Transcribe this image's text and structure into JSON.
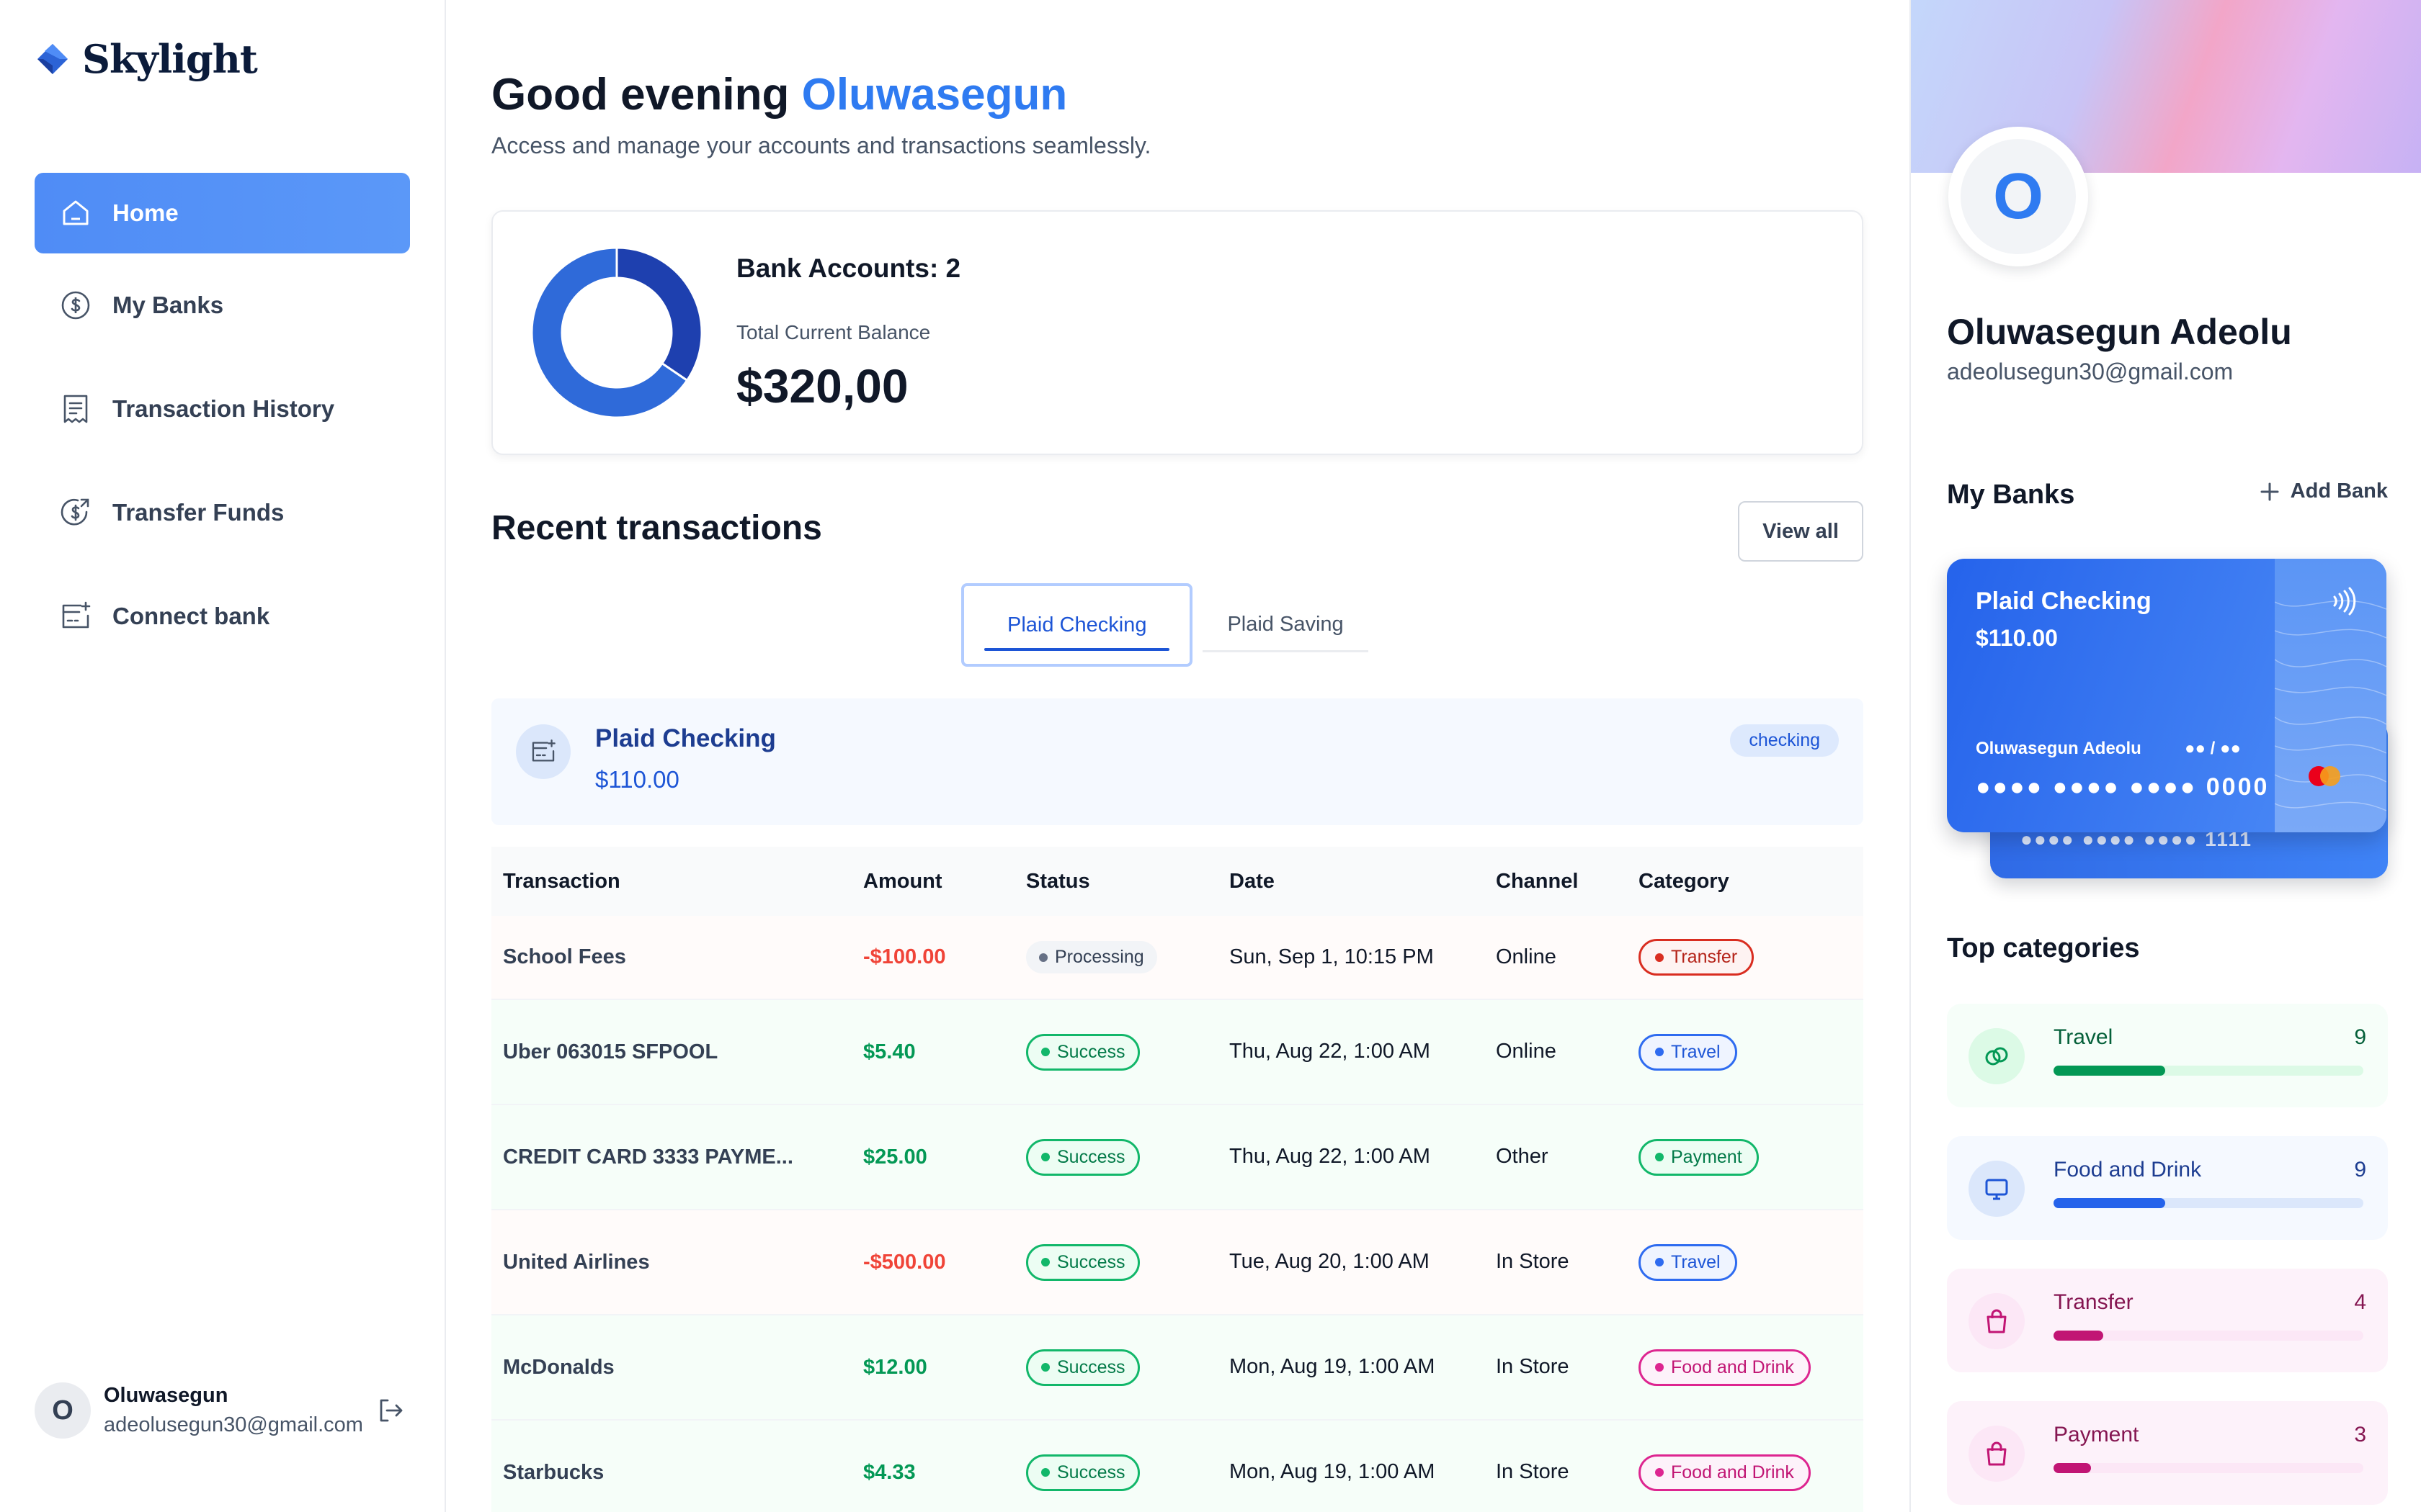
{
  "app": {
    "name": "Skylight"
  },
  "sidebar": {
    "items": [
      {
        "label": "Home",
        "icon": "home-icon",
        "active": true
      },
      {
        "label": "My Banks",
        "icon": "dollar-circle-icon",
        "active": false
      },
      {
        "label": "Transaction History",
        "icon": "receipt-icon",
        "active": false
      },
      {
        "label": "Transfer Funds",
        "icon": "money-send-icon",
        "active": false
      },
      {
        "label": "Connect bank",
        "icon": "connect-bank-icon",
        "active": false
      }
    ],
    "footer": {
      "avatar_initial": "O",
      "name": "Oluwasegun",
      "email": "adeolusegun30@gmail.com",
      "logout_icon": "logout-icon"
    }
  },
  "header": {
    "greeting_prefix": "Good evening",
    "user_first_name": "Oluwasegun",
    "subtitle": "Access and manage your accounts and transactions seamlessly."
  },
  "balance": {
    "bank_accounts_label": "Bank Accounts: 2",
    "total_label": "Total Current Balance",
    "total_value": "$320,00",
    "donut_shares": [
      0.345,
      0.655
    ],
    "donut_colors": [
      "#1e40af",
      "#2f6ad9"
    ]
  },
  "recent": {
    "title": "Recent transactions",
    "view_all_label": "View all",
    "tabs": [
      {
        "label": "Plaid Checking",
        "active": true
      },
      {
        "label": "Plaid Saving",
        "active": false
      }
    ],
    "account": {
      "name": "Plaid Checking",
      "balance": "$110.00",
      "badge": "checking"
    },
    "columns": [
      "Transaction",
      "Amount",
      "Status",
      "Date",
      "Channel",
      "Category"
    ],
    "rows": [
      {
        "name": "School Fees",
        "amount": "-$100.00",
        "type": "debit",
        "status": "Processing",
        "date": "Sun, Sep 1, 10:15 PM",
        "channel": "Online",
        "category": "Transfer",
        "cat_class": "cat-transfer"
      },
      {
        "name": "Uber 063015 SFPOOL",
        "amount": "$5.40",
        "type": "credit",
        "status": "Success",
        "date": "Thu, Aug 22, 1:00 AM",
        "channel": "Online",
        "category": "Travel",
        "cat_class": "cat-travel"
      },
      {
        "name": "CREDIT CARD 3333 PAYME...",
        "amount": "$25.00",
        "type": "credit",
        "status": "Success",
        "date": "Thu, Aug 22, 1:00 AM",
        "channel": "Other",
        "category": "Payment",
        "cat_class": "cat-payment"
      },
      {
        "name": "United Airlines",
        "amount": "-$500.00",
        "type": "debit",
        "status": "Success",
        "date": "Tue, Aug 20, 1:00 AM",
        "channel": "In Store",
        "category": "Travel",
        "cat_class": "cat-travel"
      },
      {
        "name": "McDonalds",
        "amount": "$12.00",
        "type": "credit",
        "status": "Success",
        "date": "Mon, Aug 19, 1:00 AM",
        "channel": "In Store",
        "category": "Food and Drink",
        "cat_class": "cat-food"
      },
      {
        "name": "Starbucks",
        "amount": "$4.33",
        "type": "credit",
        "status": "Success",
        "date": "Mon, Aug 19, 1:00 AM",
        "channel": "In Store",
        "category": "Food and Drink",
        "cat_class": "cat-food"
      }
    ]
  },
  "profile": {
    "avatar_initial": "O",
    "name": "Oluwasegun Adeolu",
    "email": "adeolusegun30@gmail.com"
  },
  "my_banks": {
    "title": "My Banks",
    "add_label": "Add Bank",
    "card": {
      "name": "Plaid Checking",
      "balance": "$110.00",
      "owner": "Oluwasegun Adeolu",
      "expiry": "●● / ●●",
      "number": "●●●● ●●●● ●●●● 0000"
    },
    "back_card_number": "●●●● ●●●● ●●●● 1111"
  },
  "top_categories": {
    "title": "Top categories",
    "items": [
      {
        "name": "Travel",
        "count": "9",
        "fill": 0.36,
        "icon": "link-icon",
        "bg": "#f6fef9",
        "circle": "#dcfae6",
        "track": "#dcfae6",
        "bar": "#039855",
        "text": "#05603a",
        "icon_color": "#039855"
      },
      {
        "name": "Food and Drink",
        "count": "9",
        "fill": 0.36,
        "icon": "monitor-icon",
        "bg": "#f5f9ff",
        "circle": "#dbe7fb",
        "track": "#dbe7fb",
        "bar": "#2563eb",
        "text": "#1d3d91",
        "icon_color": "#1d55d6"
      },
      {
        "name": "Transfer",
        "count": "4",
        "fill": 0.16,
        "icon": "shopping-bag-icon",
        "bg": "#fdf2fa",
        "circle": "#fce7f6",
        "track": "#fce7f6",
        "bar": "#c11574",
        "text": "#851651",
        "icon_color": "#c11574"
      },
      {
        "name": "Payment",
        "count": "3",
        "fill": 0.12,
        "icon": "shopping-bag-icon",
        "bg": "#fdf2fa",
        "circle": "#fce7f6",
        "track": "#fce7f6",
        "bar": "#c11574",
        "text": "#851651",
        "icon_color": "#c11574"
      }
    ]
  },
  "colors": {
    "accent": "#2f7bf1",
    "nav_active": "#4f8cf6"
  }
}
